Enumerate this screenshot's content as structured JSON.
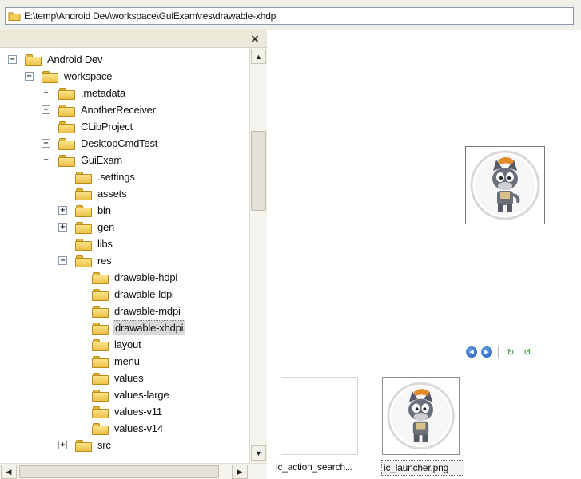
{
  "address_bar": {
    "path": "E:\\temp\\Android Dev\\workspace\\GuiExam\\res\\drawable-xhdpi"
  },
  "folder_pane": {
    "close_glyph": "×",
    "selected": "drawable-xhdpi",
    "tree": [
      {
        "label": "Android Dev",
        "level": 0,
        "expander": "minus"
      },
      {
        "label": "workspace",
        "level": 1,
        "expander": "minus"
      },
      {
        "label": ".metadata",
        "level": 2,
        "expander": "plus"
      },
      {
        "label": "AnotherReceiver",
        "level": 2,
        "expander": "plus"
      },
      {
        "label": "CLibProject",
        "level": 2,
        "expander": "none"
      },
      {
        "label": "DesktopCmdTest",
        "level": 2,
        "expander": "plus"
      },
      {
        "label": "GuiExam",
        "level": 2,
        "expander": "minus"
      },
      {
        "label": ".settings",
        "level": 3,
        "expander": "none"
      },
      {
        "label": "assets",
        "level": 3,
        "expander": "none"
      },
      {
        "label": "bin",
        "level": 3,
        "expander": "plus"
      },
      {
        "label": "gen",
        "level": 3,
        "expander": "plus"
      },
      {
        "label": "libs",
        "level": 3,
        "expander": "none"
      },
      {
        "label": "res",
        "level": 3,
        "expander": "minus"
      },
      {
        "label": "drawable-hdpi",
        "level": 4,
        "expander": "none"
      },
      {
        "label": "drawable-ldpi",
        "level": 4,
        "expander": "none"
      },
      {
        "label": "drawable-mdpi",
        "level": 4,
        "expander": "none"
      },
      {
        "label": "drawable-xhdpi",
        "level": 4,
        "expander": "none"
      },
      {
        "label": "layout",
        "level": 4,
        "expander": "none"
      },
      {
        "label": "menu",
        "level": 4,
        "expander": "none"
      },
      {
        "label": "values",
        "level": 4,
        "expander": "none"
      },
      {
        "label": "values-large",
        "level": 4,
        "expander": "none"
      },
      {
        "label": "values-v11",
        "level": 4,
        "expander": "none"
      },
      {
        "label": "values-v14",
        "level": 4,
        "expander": "none"
      },
      {
        "label": "src",
        "level": 3,
        "expander": "plus"
      }
    ]
  },
  "preview": {
    "viewer_buttons": [
      {
        "icon": "previous-image-icon"
      },
      {
        "icon": "next-image-icon"
      },
      {
        "icon": "rotate-clockwise-icon"
      },
      {
        "icon": "rotate-counterclockwise-icon"
      }
    ],
    "thumbnails": [
      {
        "caption": "ic_action_search...",
        "icon": "blank-image"
      },
      {
        "caption": "ic_launcher.png",
        "icon": "wolf-character-image"
      }
    ]
  },
  "colors": {
    "folder": "#f2cf5b",
    "selection": "#d8d8d8",
    "viewer_button": "#1e57b8"
  }
}
